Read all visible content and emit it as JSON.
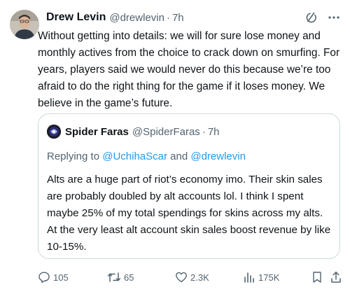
{
  "tweet": {
    "display_name": "Drew Levin",
    "handle": "@drewlevin",
    "separator": "·",
    "time": "7h",
    "text": "Without getting into details: we will for sure lose money and monthly actives from the choice to crack down on smurfing. For years, players said we would never do this because we’re too afraid to do the right thing for the game if it loses money. We believe in the game’s future."
  },
  "quote": {
    "display_name": "Spider Faras",
    "handle": "@SpiderFaras",
    "separator": "·",
    "time": "7h",
    "replying_prefix": "Replying to ",
    "replying_mention_1": "@UchihaScar",
    "replying_and": " and ",
    "replying_mention_2": "@drewlevin",
    "text": "Alts are a huge part of riot’s economy imo. Their skin sales are probably doubled by alt accounts lol. I think I spent maybe 25% of my total spendings for skins across my alts. At the very least alt account skin sales boost revenue by like 10-15%."
  },
  "actions": {
    "replies": "105",
    "retweets": "65",
    "likes": "2.3K",
    "views": "175K"
  },
  "icons": {
    "grok": "grok-icon",
    "more": "more-icon",
    "reply": "reply-icon",
    "retweet": "retweet-icon",
    "like": "heart-icon",
    "views": "views-icon",
    "bookmark": "bookmark-icon",
    "share": "share-icon"
  },
  "colors": {
    "text": "#0f1419",
    "secondary": "#536471",
    "link": "#1d9bf0",
    "border": "#cfd9de"
  }
}
